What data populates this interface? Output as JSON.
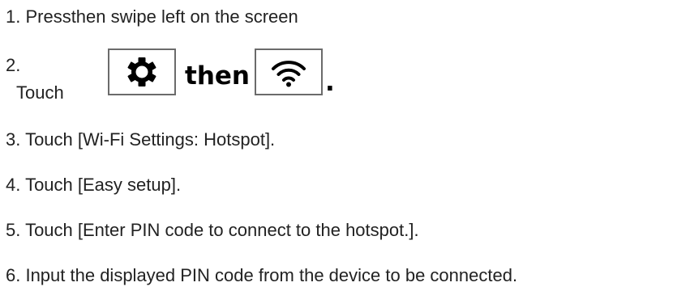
{
  "steps": {
    "s1": "1. Pressthen swipe left on the screen",
    "s2_number": "2.",
    "s2_touch": "Touch",
    "s2_then": "then",
    "s2_period": ".",
    "s3": "3. Touch [Wi-Fi Settings: Hotspot].",
    "s4": "4. Touch [Easy setup].",
    "s5": "5. Touch [Enter PIN code to connect to the hotspot.].",
    "s6": "6. Input the displayed PIN code from the device to be connected."
  },
  "icons": {
    "settings": "gear-icon",
    "wifi": "wifi-icon"
  }
}
